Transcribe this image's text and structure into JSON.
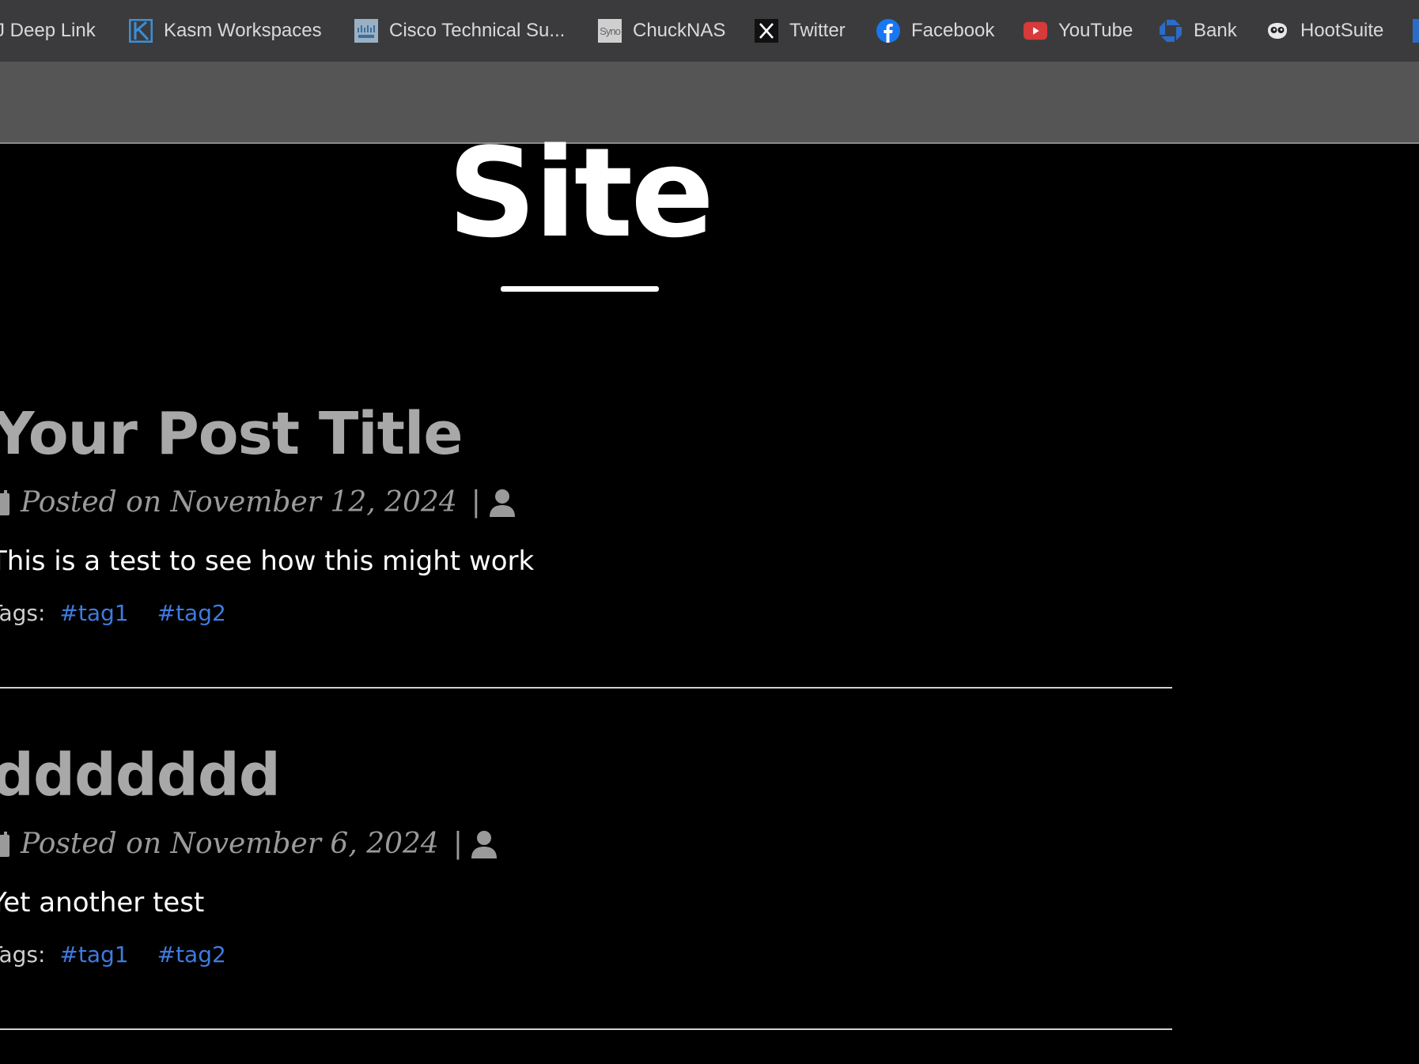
{
  "bookmarks": [
    {
      "label": "J Deep Link",
      "icon": "none"
    },
    {
      "label": "Kasm Workspaces",
      "icon": "kasm-icon"
    },
    {
      "label": "Cisco Technical Su...",
      "icon": "cisco-icon"
    },
    {
      "label": "ChuckNAS",
      "icon": "synology-icon",
      "icon_text": "Syno"
    },
    {
      "label": "Twitter",
      "icon": "x-twitter-icon"
    },
    {
      "label": "Facebook",
      "icon": "facebook-icon"
    },
    {
      "label": "YouTube",
      "icon": "youtube-icon"
    },
    {
      "label": "Bank",
      "icon": "chase-bank-icon"
    },
    {
      "label": "HootSuite",
      "icon": "hootsuite-owl-icon"
    }
  ],
  "hero": {
    "title": "Site"
  },
  "posts": [
    {
      "title": "Your Post Title",
      "meta": "Posted on November 12, 2024",
      "separator": "|",
      "excerpt": "This is a test to see how this might work",
      "tags_label": "Tags:",
      "tags": [
        "#tag1",
        "#tag2"
      ]
    },
    {
      "title": "ddddddd",
      "meta": "Posted on November 6, 2024",
      "separator": "|",
      "excerpt": "Yet another test",
      "tags_label": "Tags:",
      "tags": [
        "#tag1",
        "#tag2"
      ]
    }
  ],
  "colors": {
    "bookmarks_bg": "#3b3b3d",
    "subbar_bg": "#555555",
    "page_bg": "#000000",
    "tag_link": "#3f7ae0",
    "post_title": "#a8a8a8"
  }
}
